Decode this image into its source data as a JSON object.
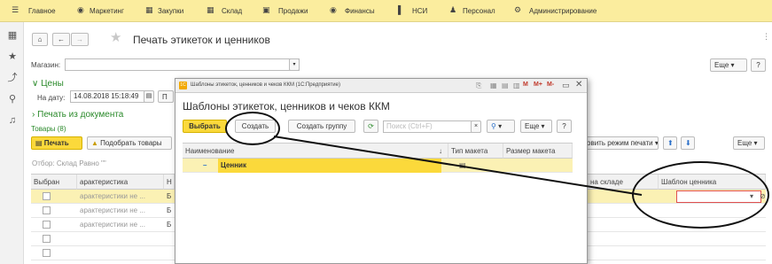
{
  "topnav": {
    "items": [
      "Главное",
      "Маркетинг",
      "Закупки",
      "Склад",
      "Продажи",
      "Финансы",
      "НСИ",
      "Персонал",
      "Администрирование"
    ]
  },
  "window": {
    "title": "Печать этикеток и ценников",
    "more_label": "Еще",
    "help_label": "?"
  },
  "form": {
    "store_label": "Магазин:",
    "store_value": "",
    "prices_section": "Цены",
    "date_label": "На дату:",
    "date_value": "14.08.2018 15:18:49",
    "print_from_doc_section": "Печать из документа",
    "goods_label": "Товары (8)",
    "print_button": "Печать",
    "select_goods_button": "Подобрать товары",
    "print_mode_button": "Установить режим печати",
    "more_label": "Еще",
    "filter_text": "Отбор: Склад Равно \"\""
  },
  "table": {
    "headers": [
      "Выбран",
      "арактеристика",
      "Н",
      "на складе",
      "Шаблон ценника"
    ],
    "rows": [
      {
        "char": "арактеристики не ...",
        "n": "Б"
      },
      {
        "char": "арактеристики не ...",
        "n": "Б"
      },
      {
        "char": "арактеристики не ...",
        "n": "Б"
      },
      {
        "char": "",
        "n": ""
      },
      {
        "char": "",
        "n": ""
      }
    ]
  },
  "modal": {
    "title": "Шаблоны этикеток, ценников и чеков ККМ (1С:Предприятие)",
    "title_buttons": [
      "M",
      "M+",
      "M-"
    ],
    "heading": "Шаблоны этикеток, ценников и чеков ККМ",
    "select_button": "Выбрать",
    "create_button": "Создать",
    "create_group_button": "Создать группу",
    "search_placeholder": "Поиск (Ctrl+F)",
    "more_label": "Еще",
    "help_label": "?",
    "columns": [
      "Наименование",
      "Тип макета",
      "Размер макета"
    ],
    "rows": [
      {
        "name": "Ценник",
        "type": "",
        "size": ""
      }
    ]
  },
  "colors": {
    "topbar": "#fbed9e",
    "accent_yellow": "#fbd93b",
    "green": "#2b8a2b",
    "selected_row": "#fbf1b4"
  }
}
